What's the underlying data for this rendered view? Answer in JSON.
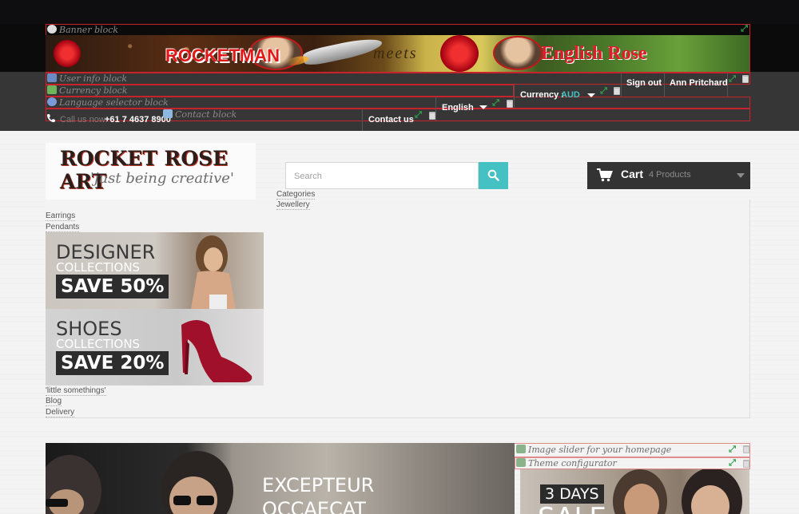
{
  "banner": {
    "block_label": "Banner block",
    "rocketman": "ROCKETMAN",
    "meets": "meets",
    "english_rose": "English Rose"
  },
  "blocks": {
    "user_info": "User info block",
    "currency": "Currency block",
    "language": "Language selector block",
    "contact": "Contact block",
    "slider": "Image slider for your homepage",
    "theme": "Theme configurator"
  },
  "nav": {
    "call_prefix": "Call us now:",
    "phone": "+61 7 4637 8900",
    "contact_us": "Contact us",
    "language_selected": "English",
    "currency_label": "Currency :",
    "currency_value": "AUD",
    "sign_out": "Sign out",
    "user_name": "Ann Pritchard"
  },
  "logo": {
    "title": "ROCKET ROSE ART",
    "tagline": "'just being creative'"
  },
  "search": {
    "placeholder": "Search"
  },
  "cart": {
    "label": "Cart",
    "count": "4 Products"
  },
  "menu": {
    "categories": "Categories",
    "jewellery": "Jewellery",
    "earrings": "Earrings",
    "pendants": "Pendants",
    "little": "'little somethings'",
    "blog": "Blog",
    "delivery": "Delivery"
  },
  "promos": [
    {
      "line1": "DESIGNER",
      "line2": "COLLECTIONS",
      "line3": "SAVE 50%"
    },
    {
      "line1": "SHOES",
      "line2": "COLLECTIONS",
      "line3": "SAVE 20%"
    }
  ],
  "slider": {
    "line1": "EXCEPTEUR",
    "line2": "OCCAECAT"
  },
  "right_slide": {
    "days": "3 DAYS",
    "sale": "SALE"
  },
  "colors": {
    "accent": "#46c1c3",
    "outline": "#c8232c",
    "cart_bg": "#333333"
  }
}
